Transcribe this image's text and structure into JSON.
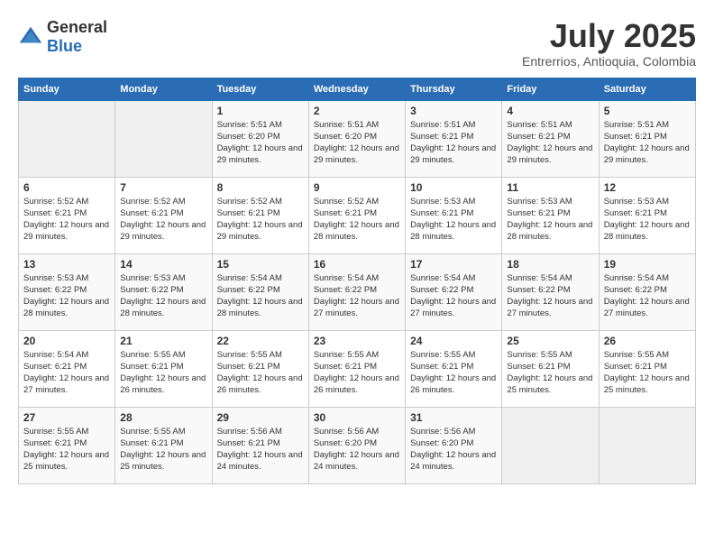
{
  "logo": {
    "general": "General",
    "blue": "Blue"
  },
  "title": {
    "month": "July 2025",
    "location": "Entrerrios, Antioquia, Colombia"
  },
  "days_of_week": [
    "Sunday",
    "Monday",
    "Tuesday",
    "Wednesday",
    "Thursday",
    "Friday",
    "Saturday"
  ],
  "weeks": [
    [
      {
        "day": "",
        "detail": ""
      },
      {
        "day": "",
        "detail": ""
      },
      {
        "day": "1",
        "detail": "Sunrise: 5:51 AM\nSunset: 6:20 PM\nDaylight: 12 hours and 29 minutes."
      },
      {
        "day": "2",
        "detail": "Sunrise: 5:51 AM\nSunset: 6:20 PM\nDaylight: 12 hours and 29 minutes."
      },
      {
        "day": "3",
        "detail": "Sunrise: 5:51 AM\nSunset: 6:21 PM\nDaylight: 12 hours and 29 minutes."
      },
      {
        "day": "4",
        "detail": "Sunrise: 5:51 AM\nSunset: 6:21 PM\nDaylight: 12 hours and 29 minutes."
      },
      {
        "day": "5",
        "detail": "Sunrise: 5:51 AM\nSunset: 6:21 PM\nDaylight: 12 hours and 29 minutes."
      }
    ],
    [
      {
        "day": "6",
        "detail": "Sunrise: 5:52 AM\nSunset: 6:21 PM\nDaylight: 12 hours and 29 minutes."
      },
      {
        "day": "7",
        "detail": "Sunrise: 5:52 AM\nSunset: 6:21 PM\nDaylight: 12 hours and 29 minutes."
      },
      {
        "day": "8",
        "detail": "Sunrise: 5:52 AM\nSunset: 6:21 PM\nDaylight: 12 hours and 29 minutes."
      },
      {
        "day": "9",
        "detail": "Sunrise: 5:52 AM\nSunset: 6:21 PM\nDaylight: 12 hours and 28 minutes."
      },
      {
        "day": "10",
        "detail": "Sunrise: 5:53 AM\nSunset: 6:21 PM\nDaylight: 12 hours and 28 minutes."
      },
      {
        "day": "11",
        "detail": "Sunrise: 5:53 AM\nSunset: 6:21 PM\nDaylight: 12 hours and 28 minutes."
      },
      {
        "day": "12",
        "detail": "Sunrise: 5:53 AM\nSunset: 6:21 PM\nDaylight: 12 hours and 28 minutes."
      }
    ],
    [
      {
        "day": "13",
        "detail": "Sunrise: 5:53 AM\nSunset: 6:22 PM\nDaylight: 12 hours and 28 minutes."
      },
      {
        "day": "14",
        "detail": "Sunrise: 5:53 AM\nSunset: 6:22 PM\nDaylight: 12 hours and 28 minutes."
      },
      {
        "day": "15",
        "detail": "Sunrise: 5:54 AM\nSunset: 6:22 PM\nDaylight: 12 hours and 28 minutes."
      },
      {
        "day": "16",
        "detail": "Sunrise: 5:54 AM\nSunset: 6:22 PM\nDaylight: 12 hours and 27 minutes."
      },
      {
        "day": "17",
        "detail": "Sunrise: 5:54 AM\nSunset: 6:22 PM\nDaylight: 12 hours and 27 minutes."
      },
      {
        "day": "18",
        "detail": "Sunrise: 5:54 AM\nSunset: 6:22 PM\nDaylight: 12 hours and 27 minutes."
      },
      {
        "day": "19",
        "detail": "Sunrise: 5:54 AM\nSunset: 6:22 PM\nDaylight: 12 hours and 27 minutes."
      }
    ],
    [
      {
        "day": "20",
        "detail": "Sunrise: 5:54 AM\nSunset: 6:21 PM\nDaylight: 12 hours and 27 minutes."
      },
      {
        "day": "21",
        "detail": "Sunrise: 5:55 AM\nSunset: 6:21 PM\nDaylight: 12 hours and 26 minutes."
      },
      {
        "day": "22",
        "detail": "Sunrise: 5:55 AM\nSunset: 6:21 PM\nDaylight: 12 hours and 26 minutes."
      },
      {
        "day": "23",
        "detail": "Sunrise: 5:55 AM\nSunset: 6:21 PM\nDaylight: 12 hours and 26 minutes."
      },
      {
        "day": "24",
        "detail": "Sunrise: 5:55 AM\nSunset: 6:21 PM\nDaylight: 12 hours and 26 minutes."
      },
      {
        "day": "25",
        "detail": "Sunrise: 5:55 AM\nSunset: 6:21 PM\nDaylight: 12 hours and 25 minutes."
      },
      {
        "day": "26",
        "detail": "Sunrise: 5:55 AM\nSunset: 6:21 PM\nDaylight: 12 hours and 25 minutes."
      }
    ],
    [
      {
        "day": "27",
        "detail": "Sunrise: 5:55 AM\nSunset: 6:21 PM\nDaylight: 12 hours and 25 minutes."
      },
      {
        "day": "28",
        "detail": "Sunrise: 5:55 AM\nSunset: 6:21 PM\nDaylight: 12 hours and 25 minutes."
      },
      {
        "day": "29",
        "detail": "Sunrise: 5:56 AM\nSunset: 6:21 PM\nDaylight: 12 hours and 24 minutes."
      },
      {
        "day": "30",
        "detail": "Sunrise: 5:56 AM\nSunset: 6:20 PM\nDaylight: 12 hours and 24 minutes."
      },
      {
        "day": "31",
        "detail": "Sunrise: 5:56 AM\nSunset: 6:20 PM\nDaylight: 12 hours and 24 minutes."
      },
      {
        "day": "",
        "detail": ""
      },
      {
        "day": "",
        "detail": ""
      }
    ]
  ]
}
